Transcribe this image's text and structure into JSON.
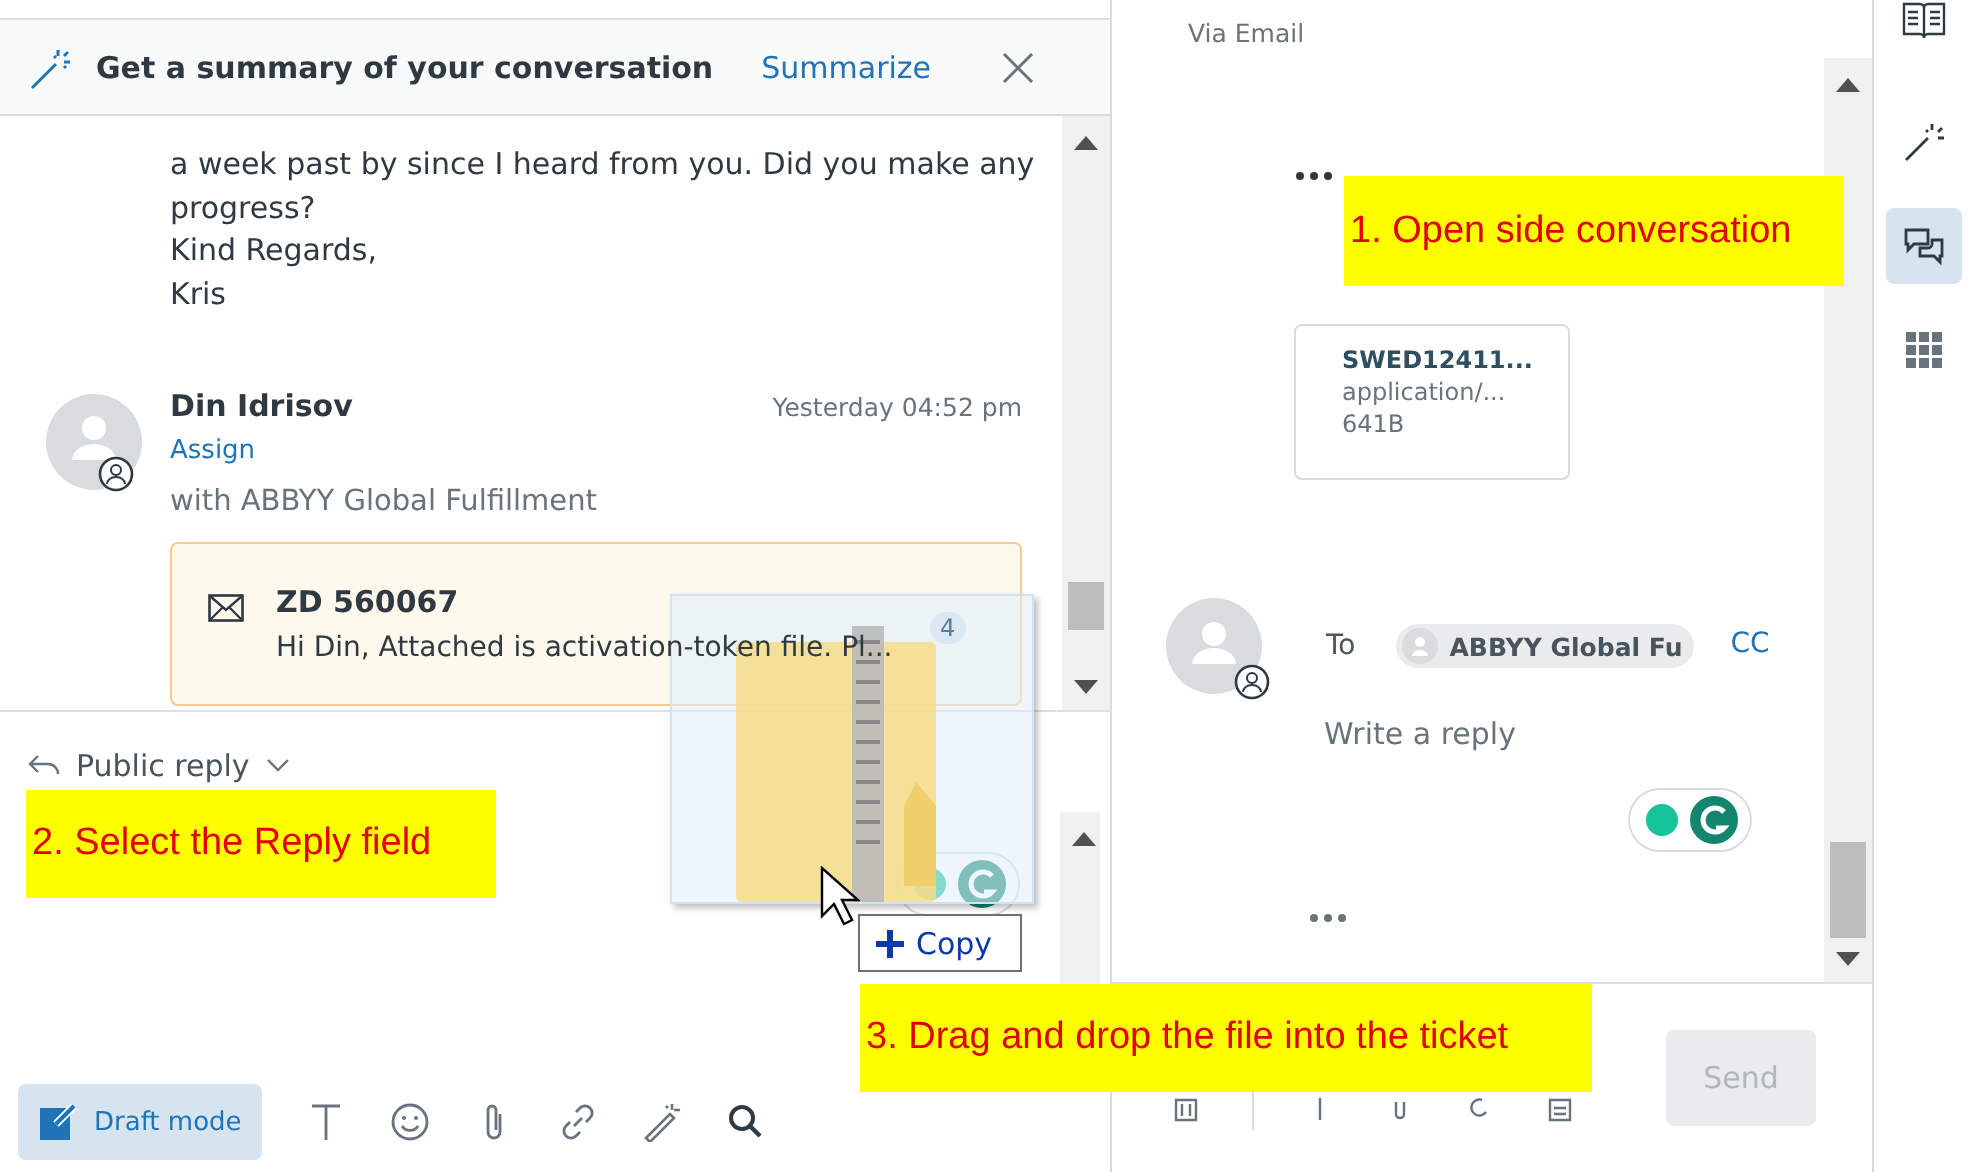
{
  "banner": {
    "title": "Get a summary of your conversation",
    "action": "Summarize"
  },
  "thread": {
    "body_lines": [
      "a week past by since I heard from you. Did you make any",
      "progress?",
      "Kind Regards,",
      "Kris"
    ],
    "author": "Din Idrisov",
    "time": "Yesterday 04:52 pm",
    "assign": "Assign",
    "via": "with ABBYY Global Fulfillment",
    "card": {
      "title": "ZD 560067",
      "preview": "Hi Din, Attached is activation-token file. Pl..."
    }
  },
  "reply": {
    "mode": "Public reply",
    "draft_button": "Draft mode"
  },
  "side_conversation": {
    "channel": "Via Email",
    "attachment": {
      "name": "SWED12411...",
      "type": "application/...",
      "size": "641B"
    },
    "to_label": "To",
    "recipient": "ABBYY Global Fu",
    "cc": "CC",
    "placeholder": "Write a reply",
    "send": {
      "label": "Send",
      "disabled": true
    }
  },
  "rail": [
    {
      "kind": "book",
      "selected": false
    },
    {
      "kind": "wand",
      "selected": false
    },
    {
      "kind": "chat",
      "selected": true
    },
    {
      "kind": "apps",
      "selected": false
    }
  ],
  "callouts": [
    "1. Open side conversation",
    "2. Select the Reply field",
    "3. Drag and drop the file into the ticket"
  ],
  "drag": {
    "count": "4",
    "effect": "Copy"
  }
}
